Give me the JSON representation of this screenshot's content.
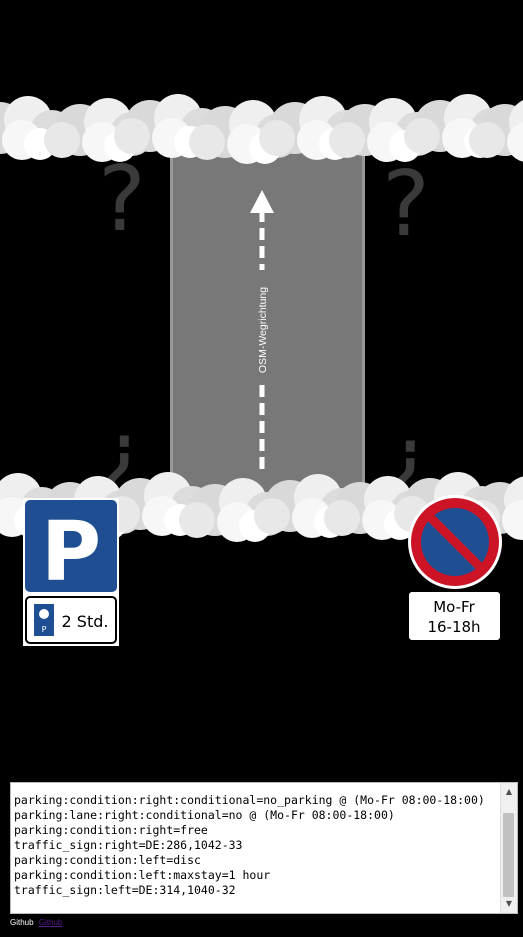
{
  "road": {
    "direction_label": "OSM-Wegrichtung"
  },
  "signs": {
    "left": {
      "main_letter": "P",
      "plate_text": "2 Std.",
      "plate_icon_letter": "P"
    },
    "right": {
      "plate_line1": "Mo-Fr",
      "plate_line2": "16-18h"
    }
  },
  "tags_text": "parking:condition:right:conditional=no_parking @ (Mo-Fr 08:00-18:00)\nparking:lane:right:conditional=no @ (Mo-Fr 08:00-18:00)\nparking:condition:right=free\ntraffic_sign:right=DE:286,1042-33\nparking:condition:left=disc\nparking:condition:left:maxstay=1 hour\ntraffic_sign:left=DE:314,1040-32",
  "footer": {
    "label": "Github",
    "link_text": "Github"
  },
  "colors": {
    "sign_blue": "#1f4e93",
    "sign_red": "#cc1426",
    "road_grey": "#787878"
  }
}
